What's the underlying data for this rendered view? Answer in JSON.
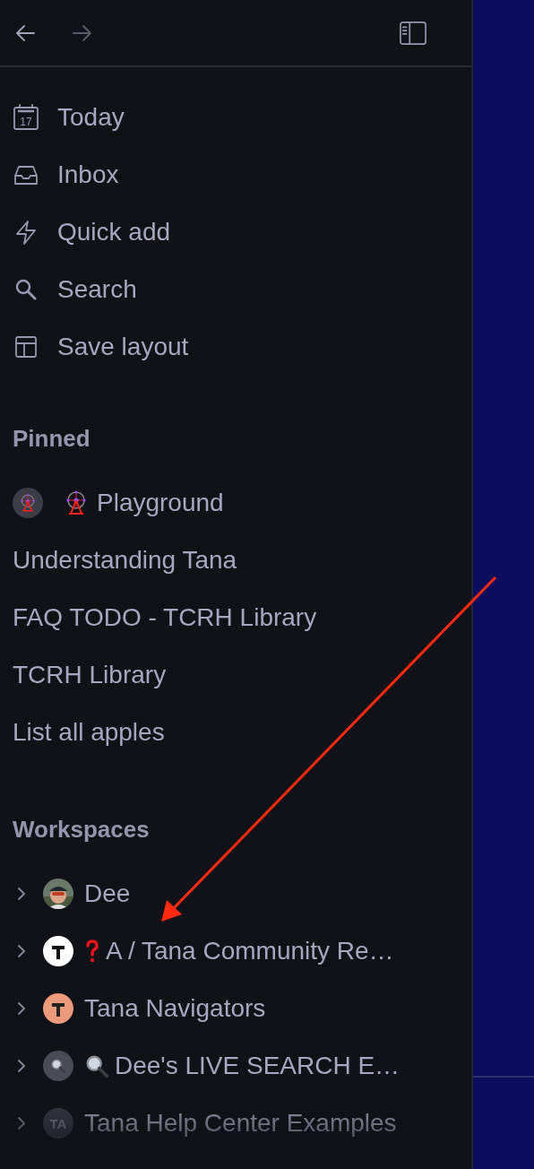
{
  "nav": [
    {
      "kind": "calendar",
      "date": "17",
      "label": "Today"
    },
    {
      "kind": "inbox",
      "label": "Inbox"
    },
    {
      "kind": "bolt",
      "label": "Quick add"
    },
    {
      "kind": "search",
      "label": "Search"
    },
    {
      "kind": "layout",
      "label": "Save layout"
    }
  ],
  "pinned": {
    "title": "Pinned",
    "items": [
      {
        "kind": "ferris",
        "label": "Playground"
      },
      {
        "kind": "plain",
        "label": "Understanding Tana"
      },
      {
        "kind": "plain",
        "label": "FAQ TODO - TCRH Library"
      },
      {
        "kind": "plain",
        "label": "TCRH Library"
      },
      {
        "kind": "plain",
        "label": "List all apples"
      }
    ]
  },
  "workspaces": {
    "title": "Workspaces",
    "items": [
      {
        "label": "Dee",
        "expanded": false
      },
      {
        "kind": "question",
        "label": "A / Tana Community Re…",
        "expanded": false
      },
      {
        "kind": "orange",
        "label": "Tana Navigators",
        "expanded": false
      },
      {
        "kind": "magnifier",
        "label": "Dee's LIVE SEARCH E…",
        "expanded": false
      },
      {
        "kind": "initials",
        "initials": "TA",
        "label": "Tana Help Center Examples",
        "expanded": false
      }
    ]
  }
}
